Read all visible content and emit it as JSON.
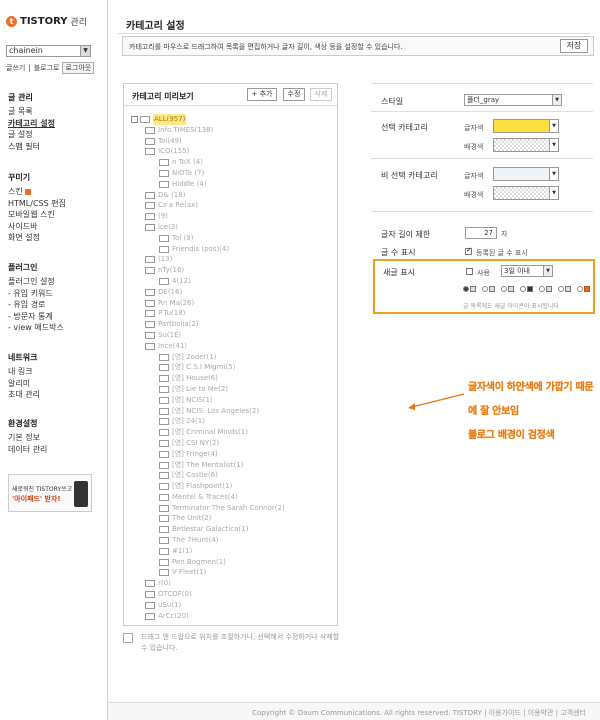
{
  "sidebar": {
    "logo_text": "TISTORY",
    "logo_sub": "관리",
    "blog_select": "chainein",
    "links": [
      "글쓰기",
      "블로그로",
      "로그아웃"
    ],
    "groups": [
      {
        "title": "글 관리",
        "items": [
          "글 목록",
          "카테고리 설정",
          "글 설정",
          "스팸 필터"
        ]
      },
      {
        "title": "꾸미기",
        "items": [
          "스킨",
          "HTML/CSS 편집",
          "모바일웹 스킨",
          "사이드바",
          "화면 설정"
        ]
      },
      {
        "title": "플러그인",
        "items": [
          "플러그인 설정",
          "- 유입 키워드",
          "- 유입 경로",
          "- 방문자 통계",
          "- view 애드박스"
        ]
      },
      {
        "title": "네트워크",
        "items": [
          "내 링크",
          "알리미",
          "초대 관리"
        ]
      },
      {
        "title": "환경설정",
        "items": [
          "기본 정보",
          "데이터 관리"
        ]
      }
    ],
    "ad": {
      "line1": "새로워진 TISTORY쓰고",
      "line2": "'아이패드' 받자!"
    }
  },
  "main": {
    "title": "카테고리 설정",
    "description": "카테고리를 마우스로 드래그하여 목록을 편집하거나 글자 길이, 색상 등을 설정할 수 있습니다.",
    "save_label": "저장"
  },
  "preview": {
    "title": "카테고리 미리보기",
    "add_label": "+ 추가",
    "edit_label": "수정",
    "delete_label": "삭제",
    "root_label": "ALL(957)",
    "nodes": [
      {
        "level": 1,
        "label": "Info.TIMES(138)"
      },
      {
        "level": 1,
        "label": "Toi(49)"
      },
      {
        "level": 1,
        "label": "ICO(155)"
      },
      {
        "level": 2,
        "label": "n ToX (4)"
      },
      {
        "level": 2,
        "label": "NiOTa (7)"
      },
      {
        "level": 2,
        "label": "Hiddle (4)"
      },
      {
        "level": 1,
        "label": "D& (18)"
      },
      {
        "level": 1,
        "label": "Cs a Re(ax)"
      },
      {
        "level": 1,
        "label": "(9)"
      },
      {
        "level": 1,
        "label": "ice(3)"
      },
      {
        "level": 2,
        "label": "Tol (9)"
      },
      {
        "level": 2,
        "label": "Friendis (pos)(4)"
      },
      {
        "level": 1,
        "label": "(13)"
      },
      {
        "level": 1,
        "label": "nTy(16)"
      },
      {
        "level": 2,
        "label": "4(12)"
      },
      {
        "level": 1,
        "label": "DE(16)"
      },
      {
        "level": 1,
        "label": "Rn Ma(26)"
      },
      {
        "level": 1,
        "label": "P.Tu(18)"
      },
      {
        "level": 1,
        "label": "Partbolia(2)"
      },
      {
        "level": 1,
        "label": "Su(1E)"
      },
      {
        "level": 1,
        "label": "Ince(41)"
      },
      {
        "level": 2,
        "label": "[영] 2oder(1)"
      },
      {
        "level": 2,
        "label": "[영] C.S.I Migmi(5)"
      },
      {
        "level": 2,
        "label": "[영] House(6)"
      },
      {
        "level": 2,
        "label": "[영] Lie to Me(2)"
      },
      {
        "level": 2,
        "label": "[영] NCIS(1)"
      },
      {
        "level": 2,
        "label": "[영] NCIS: Los Angeles(2)"
      },
      {
        "level": 2,
        "label": "[영] 24(1)"
      },
      {
        "level": 2,
        "label": "[영] Criminal Minds(1)"
      },
      {
        "level": 2,
        "label": "[영] CSI NY(2)"
      },
      {
        "level": 2,
        "label": "[영] Fringe(4)"
      },
      {
        "level": 2,
        "label": "[영] The Mentalist(1)"
      },
      {
        "level": 2,
        "label": "[영] Castle(6)"
      },
      {
        "level": 2,
        "label": "[영] Flashpoint(1)"
      },
      {
        "level": 2,
        "label": "Mentel & Traces(4)"
      },
      {
        "level": 2,
        "label": "Terminator The Sarah Connor(2)"
      },
      {
        "level": 2,
        "label": "The Unit(2)"
      },
      {
        "level": 2,
        "label": "Betlestar Galactica(1)"
      },
      {
        "level": 2,
        "label": "The 7Hunt(4)"
      },
      {
        "level": 2,
        "label": "#1(1)"
      },
      {
        "level": 2,
        "label": "Pen Bogmen(1)"
      },
      {
        "level": 2,
        "label": "V Fleet(1)"
      },
      {
        "level": 1,
        "label": "r(0)"
      },
      {
        "level": 1,
        "label": "OTCOF(0)"
      },
      {
        "level": 1,
        "label": "uSu(1)"
      },
      {
        "level": 1,
        "label": "ArCc(20)"
      }
    ],
    "hint": "드래그 앤 드랍으로 위치를 조절하거나, 선택해서 수정하거나 삭제할 수 있습니다."
  },
  "style_panel": {
    "style_label": "스타일",
    "style_value": "폴더_gray",
    "selected_label": "선택 카테고리",
    "unselected_label": "비 선택 카테고리",
    "text_color_label": "글자색",
    "bg_color_label": "배경색",
    "selected_text_color": "#fde040",
    "unselected_text_color": "#eef4f8",
    "length_label": "글자 길이 제한",
    "length_value": "27",
    "length_unit": "자",
    "count_label": "글 수 표시",
    "count_checkbox_label": "등록된 글 수 표시",
    "count_checked": true,
    "new_label": "새글 표시",
    "new_use_label": "사용",
    "new_use_checked": false,
    "new_period": "3일 이내",
    "new_note": "글 목록에도 새글 아이콘이 표시됩니다."
  },
  "annotation": {
    "line1": "글자색이 하얀색에 가깝기 때문에 잘 안보임",
    "line2": "블로그 배경이 검정색",
    "color": "#e87810"
  },
  "footer": {
    "text": "Copyright © Daum Communications. All rights reserved. TISTORY | 이용가이드 | 이용약관 | 고객센터"
  }
}
